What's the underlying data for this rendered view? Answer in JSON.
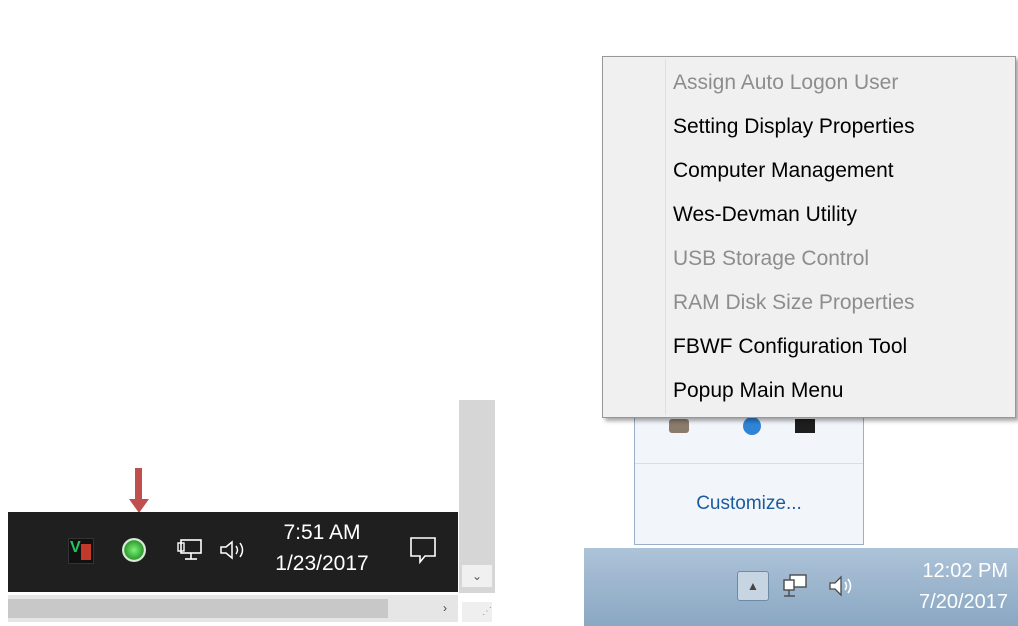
{
  "left_panel": {
    "clock": {
      "time": "7:51 AM",
      "date": "1/23/2017"
    },
    "tray_icons": [
      "vc-icon",
      "green-ball-icon",
      "network-icon",
      "volume-icon"
    ],
    "notification_icon": "action-center-icon",
    "accent_arrow_color": "#c0504d"
  },
  "right_panel": {
    "context_menu": {
      "items": [
        {
          "label": "Assign Auto Logon User",
          "enabled": false
        },
        {
          "label": "Setting Display Properties",
          "enabled": true
        },
        {
          "label": "Computer Management",
          "enabled": true
        },
        {
          "label": "Wes-Devman Utility",
          "enabled": true
        },
        {
          "label": "USB Storage Control",
          "enabled": false
        },
        {
          "label": "RAM Disk Size Properties",
          "enabled": false
        },
        {
          "label": "FBWF Configuration Tool",
          "enabled": true
        },
        {
          "label": "Popup Main Menu",
          "enabled": true
        }
      ]
    },
    "tray_popup": {
      "customize_label": "Customize..."
    },
    "clock": {
      "time": "12:02 PM",
      "date": "7/20/2017"
    }
  }
}
